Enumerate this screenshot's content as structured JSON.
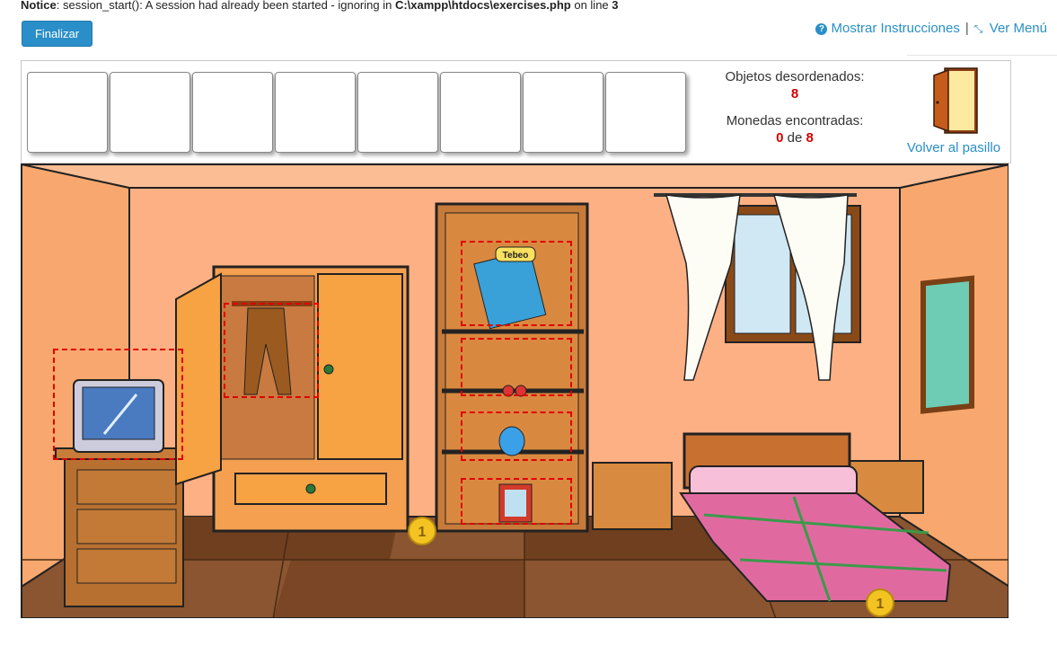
{
  "notice": {
    "label": "Notice",
    "text_1": ": session_start(): A session had already been started - ignoring in ",
    "path": "C:\\xampp\\htdocs\\exercises.php",
    "text_2": " on line ",
    "line": "3"
  },
  "header": {
    "finish_button": "Finalizar",
    "instructions_link": "Mostrar Instrucciones",
    "separator": "|",
    "menu_link": "Ver Menú"
  },
  "inventory": {
    "slot_count": 8
  },
  "stats": {
    "disordered_label": "Objetos desordenados:",
    "disordered_value": "8",
    "coins_label": "Monedas encontradas:",
    "coins_found": "0",
    "coins_of": "de",
    "coins_total": "8"
  },
  "door": {
    "label": "Volver al pasillo"
  },
  "scene": {
    "comic_title": "Tebeo",
    "coin_text": "1",
    "items": [
      "tv",
      "trousers",
      "comic",
      "earrings",
      "yoyo",
      "photo-frame"
    ]
  },
  "colors": {
    "accent": "#2a8fc8",
    "wall": "#fdb083",
    "floor": "#8a5530",
    "highlight": "#e00000",
    "counter_red": "#d40000"
  }
}
